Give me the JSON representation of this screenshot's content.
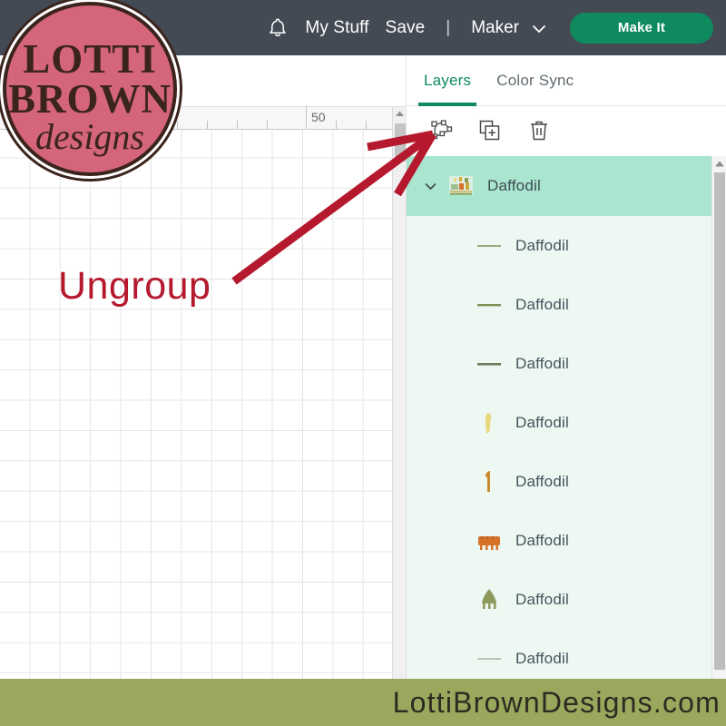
{
  "app": {
    "header": {
      "bell_icon": "bell-icon",
      "my_stuff_label": "My Stuff",
      "save_label": "Save",
      "separator": "|",
      "machine_label": "Maker",
      "machine_chevron_icon": "chevron-down-icon",
      "make_it_label": "Make It",
      "bar_color": "#434a54",
      "make_it_color": "#0f8a5f"
    },
    "canvas": {
      "ruler_labels": [
        "50"
      ],
      "scrollbar_up_icon": "caret-up-icon"
    },
    "panel": {
      "tabs": [
        {
          "label": "Layers",
          "active": true
        },
        {
          "label": "Color Sync",
          "active": false
        }
      ],
      "accent_color": "#0f8a5f",
      "toolbar": [
        {
          "name": "ungroup-button",
          "icon": "ungroup-icon"
        },
        {
          "name": "duplicate-button",
          "icon": "duplicate-icon"
        },
        {
          "name": "delete-button",
          "icon": "trash-icon"
        }
      ],
      "group_row": {
        "name": "Daffodil",
        "expanded": true,
        "chevron_icon": "chevron-down-icon",
        "thumbnail": "daffodil-image-thumbnail",
        "background_color": "#a9e5cf"
      },
      "child_rows_background": "#edf8f3",
      "layers": [
        {
          "name": "Daffodil",
          "thumbnail": "line-thumbnail",
          "color": "#9aa97e"
        },
        {
          "name": "Daffodil",
          "thumbnail": "line-thumbnail",
          "color": "#7f8f55"
        },
        {
          "name": "Daffodil",
          "thumbnail": "line-thumbnail",
          "color": "#707a5c"
        },
        {
          "name": "Daffodil",
          "thumbnail": "petal-thumbnail",
          "color": "#e8d87a"
        },
        {
          "name": "Daffodil",
          "thumbnail": "stem-thumbnail",
          "color": "#c98a2a"
        },
        {
          "name": "Daffodil",
          "thumbnail": "trumpet-thumbnail",
          "color": "#d4722a"
        },
        {
          "name": "Daffodil",
          "thumbnail": "leaf-thumbnail",
          "color": "#8d9a5a"
        },
        {
          "name": "Daffodil",
          "thumbnail": "line-thumbnail",
          "color": "#b9c4bd"
        }
      ],
      "scrollbar_up_icon": "caret-up-icon"
    }
  },
  "watermark": {
    "logo_line1": "LOTTI",
    "logo_line2": "BROWN",
    "logo_line3": "designs",
    "logo_bg_color": "#d4657a",
    "logo_ink_color": "#3b241c"
  },
  "annotation": {
    "label": "Ungroup",
    "color": "#b5192e",
    "arrow_icon": "arrow-pointing-up-right-icon"
  },
  "footer": {
    "text": "LottiBrownDesigns.com",
    "background_color": "#99a85c"
  }
}
